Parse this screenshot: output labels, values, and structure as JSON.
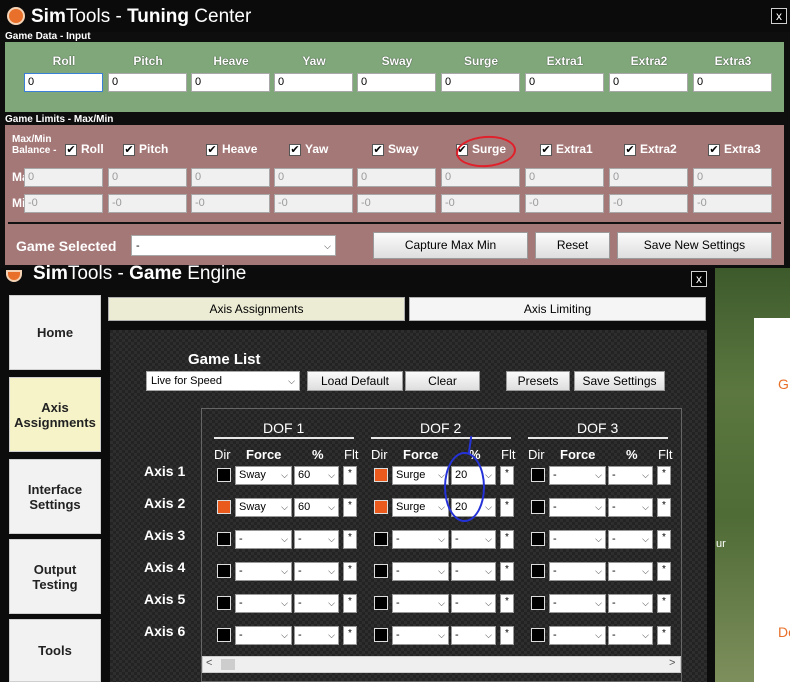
{
  "tuning": {
    "title_prefix": "Sim",
    "title_mid": "Tools - ",
    "title_bold": "Tuning",
    "title_suffix": " Center",
    "close": "x",
    "game_data_label": "Game Data - Input",
    "game_limits_label": "Game Limits - Max/Min",
    "columns": [
      "Roll",
      "Pitch",
      "Heave",
      "Yaw",
      "Sway",
      "Surge",
      "Extra1",
      "Extra2",
      "Extra3"
    ],
    "input_values": [
      "0",
      "0",
      "0",
      "0",
      "0",
      "0",
      "0",
      "0",
      "0"
    ],
    "balance_label_line1": "Max/Min",
    "balance_label_line2": "Balance -",
    "check_mark": "✔",
    "max_label": "Max",
    "min_label": "Min",
    "max_values": [
      "0",
      "0",
      "0",
      "0",
      "0",
      "0",
      "0",
      "0",
      "0"
    ],
    "min_values": [
      "-0",
      "-0",
      "-0",
      "-0",
      "-0",
      "-0",
      "-0",
      "-0",
      "-0"
    ],
    "game_selected_label": "Game Selected",
    "game_selected_value": "-",
    "capture_btn": "Capture Max Min",
    "reset_btn": "Reset",
    "save_new_btn": "Save New Settings"
  },
  "engine": {
    "title_prefix": "Sim",
    "title_mid": "Tools - ",
    "title_bold": "Game",
    "title_suffix": " Engine",
    "close": "x",
    "sidebar": [
      "Home",
      "Axis Assignments",
      "Interface Settings",
      "Output Testing",
      "Tools"
    ],
    "tabs": [
      "Axis Assignments",
      "Axis Limiting"
    ],
    "game_list_label": "Game List",
    "game_list_value": "Live for Speed",
    "load_default": "Load Default",
    "clear": "Clear",
    "presets": "Presets",
    "save_settings": "Save Settings",
    "dof_headers": [
      "DOF 1",
      "DOF 2",
      "DOF 3"
    ],
    "col_headers": {
      "dir": "Dir",
      "force": "Force",
      "pct": "%",
      "flt": "Flt"
    },
    "flt_symbol": "*",
    "axes": [
      {
        "label": "Axis 1",
        "cells": [
          {
            "dir": false,
            "force": "Sway",
            "pct": "60"
          },
          {
            "dir": true,
            "force": "Surge",
            "pct": "20"
          },
          {
            "dir": false,
            "force": "-",
            "pct": "-"
          }
        ]
      },
      {
        "label": "Axis 2",
        "cells": [
          {
            "dir": true,
            "force": "Sway",
            "pct": "60"
          },
          {
            "dir": true,
            "force": "Surge",
            "pct": "20"
          },
          {
            "dir": false,
            "force": "-",
            "pct": "-"
          }
        ]
      },
      {
        "label": "Axis 3",
        "cells": [
          {
            "dir": false,
            "force": "-",
            "pct": "-"
          },
          {
            "dir": false,
            "force": "-",
            "pct": "-"
          },
          {
            "dir": false,
            "force": "-",
            "pct": "-"
          }
        ]
      },
      {
        "label": "Axis 4",
        "cells": [
          {
            "dir": false,
            "force": "-",
            "pct": "-"
          },
          {
            "dir": false,
            "force": "-",
            "pct": "-"
          },
          {
            "dir": false,
            "force": "-",
            "pct": "-"
          }
        ]
      },
      {
        "label": "Axis 5",
        "cells": [
          {
            "dir": false,
            "force": "-",
            "pct": "-"
          },
          {
            "dir": false,
            "force": "-",
            "pct": "-"
          },
          {
            "dir": false,
            "force": "-",
            "pct": "-"
          }
        ]
      },
      {
        "label": "Axis 6",
        "cells": [
          {
            "dir": false,
            "force": "-",
            "pct": "-"
          },
          {
            "dir": false,
            "force": "-",
            "pct": "-"
          },
          {
            "dir": false,
            "force": "-",
            "pct": "-"
          }
        ]
      }
    ],
    "scroll_left": "<",
    "scroll_right": ">"
  },
  "background": {
    "snippet_g": "G",
    "snippet_ur": "ur",
    "snippet_do": "Do",
    "accent": "#e8702a"
  },
  "colors": {
    "game_data_bg": "#7fa77a",
    "game_limits_bg": "#a57878",
    "dir_on": "#ea5a1c",
    "annotation_red": "#e0202a",
    "annotation_blue": "#2432d8"
  }
}
